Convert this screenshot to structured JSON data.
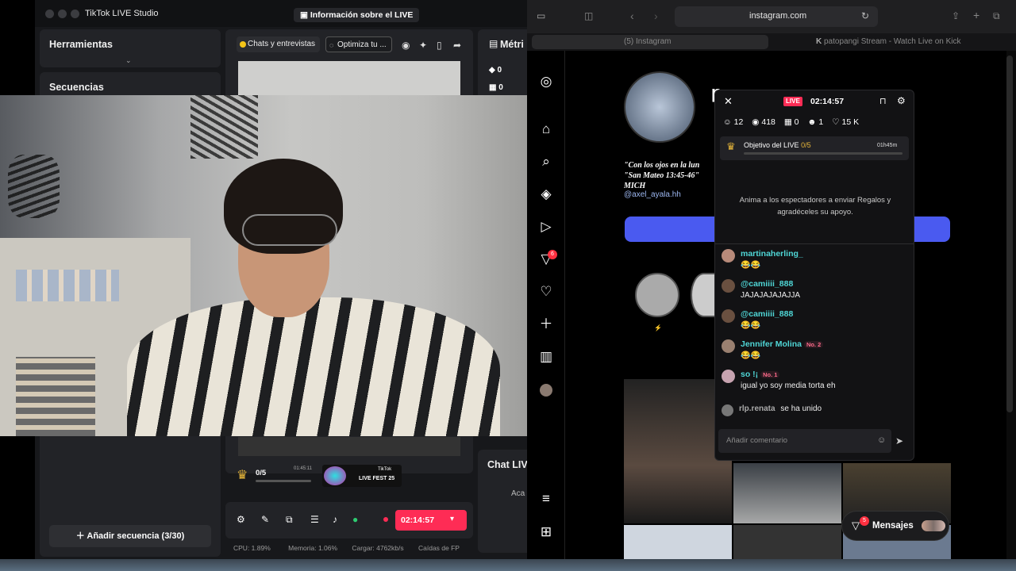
{
  "studio": {
    "app_title": "TikTok LIVE Studio",
    "info_button": "Información sobre el LIVE",
    "tools_title": "Herramientas",
    "sequences_title": "Secuencias",
    "add_sequence": "Añadir secuencia (3/30)",
    "chip_chats": "Chats y entrevistas",
    "chip_optimize": "Optimiza tu ...",
    "metrics_title": "Métri",
    "metric_coins": "0",
    "metric_gifts": "0",
    "goal_progress": "0/5",
    "goal_timer": "01:45:11",
    "fest_label": "LIVE FEST 25",
    "tiktok_label": "TikTok",
    "chat_live_title": "Chat LIV",
    "chat_live_sub": "Aca",
    "live_timer": "02:14:57",
    "cpu": "CPU: 1.89%",
    "memory": "Memoria: 1.06%",
    "load": "Cargar: 4762kb/s",
    "frames": "Caídas de FP"
  },
  "browser": {
    "url": "instagram.com",
    "tab1": "(5) Instagram",
    "tab2": "patopangi Stream - Watch Live on Kick"
  },
  "instagram": {
    "bio_line1": "\"Con los ojos en la lun",
    "bio_line2": "\"San Mateo 13:45-46\"",
    "bio_line3": "MICH",
    "bio_handle": "@axel_ayala.hh",
    "notif_badge": "6",
    "messages_label": "Mensajes",
    "messages_badge": "5",
    "username_partial": "p",
    "story_label": "⚡"
  },
  "live_panel": {
    "badge": "LIVE",
    "timer": "02:14:57",
    "stat_users": "12",
    "stat_views": "418",
    "stat_gifts": "0",
    "stat_follow": "1",
    "stat_likes": "15 K",
    "goal_title": "Objetivo del LIVE",
    "goal_progress": "0/5",
    "goal_time": "01h45m",
    "encourage": "Anima a los espectadores a enviar Regalos y agradéceles su apoyo.",
    "comment_placeholder": "Añadir comentario",
    "messages": [
      {
        "name": "martinaherling_",
        "text": "😂😂"
      },
      {
        "name": "@camiiii_888",
        "text": "JAJAJAJAJAJJA"
      },
      {
        "name": "@camiiii_888",
        "text": "😂😂"
      },
      {
        "name": "Jennifer Molina",
        "badge": "No. 2",
        "text": "😂😂"
      },
      {
        "name": "so !¡",
        "badge": "No. 1",
        "text": "igual yo soy media torta eh"
      }
    ],
    "joined_user": "rlp.renata",
    "joined_text": "se ha unido"
  }
}
